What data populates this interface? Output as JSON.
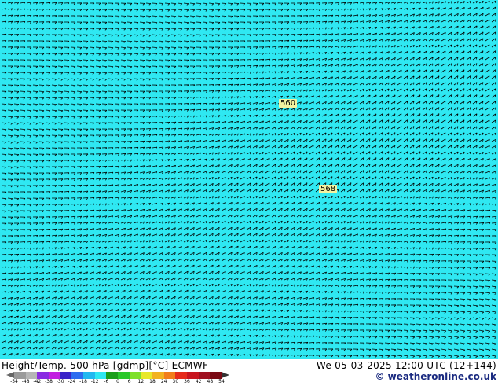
{
  "map": {
    "background_color": "#2fe8f2",
    "barb_color": "#000000",
    "contour_labels": [
      "560",
      "568"
    ]
  },
  "footer": {
    "title_left": "Height/Temp. 500 hPa [gdmp][°C] ECMWF",
    "title_right": "We 05-03-2025 12:00 UTC (12+144)",
    "credit": "© weatheronline.co.uk"
  },
  "colorbar": {
    "ticks": [
      "-54",
      "-48",
      "-42",
      "-38",
      "-30",
      "-24",
      "-18",
      "-12",
      "-6",
      "0",
      "6",
      "12",
      "18",
      "24",
      "30",
      "36",
      "42",
      "48",
      "54"
    ],
    "colors": [
      "#9a9a9a",
      "#b6b6b6",
      "#8a2be2",
      "#c21fe0",
      "#3a23c8",
      "#2d6cf0",
      "#22b8f0",
      "#2fe8f2",
      "#1a9e1a",
      "#29c829",
      "#7ee02a",
      "#e8e82a",
      "#f2b21f",
      "#f27d1a",
      "#e62a1a",
      "#c8141e",
      "#a01020",
      "#7a0a14"
    ]
  }
}
